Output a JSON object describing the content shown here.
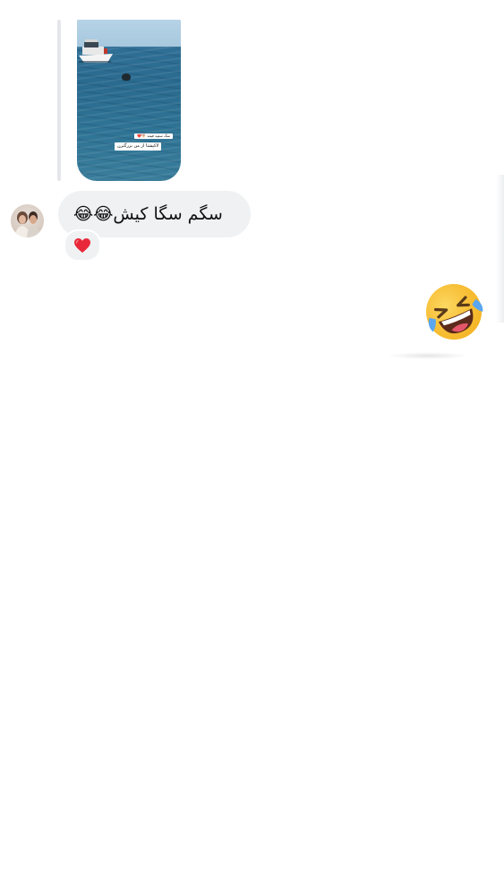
{
  "chat": {
    "shared_post": {
      "caption_top": "سگ سفید قیفه 🐕❤️",
      "caption_main": "لاکپشتا از من بزرگترن"
    },
    "message": {
      "text": "سگم سگا کیش😂😂",
      "reaction": "❤️"
    },
    "sent_emoji": "🤣"
  }
}
